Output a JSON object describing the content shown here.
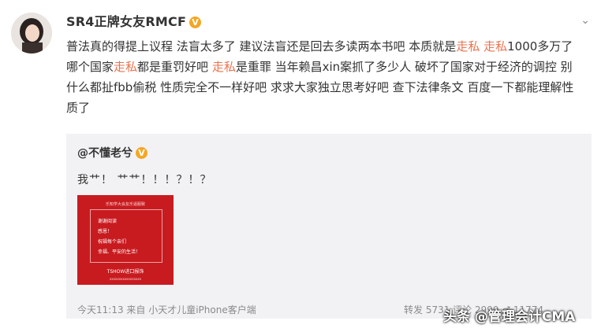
{
  "post": {
    "username": "SR4正牌女友RMCF",
    "verified_badge": "V",
    "menu_icon": "chevron-down-icon",
    "text_parts": [
      "普法真的得提上议程 法盲太多了 建议法盲还是回去多读两本书吧 本质就是",
      "走私",
      " ",
      "走私",
      "1000多万了 哪个国家",
      "走私",
      "都是重罚好吧 ",
      "走私",
      "是重罪 当年赖昌xin案抓了多少人 破坏了国家对于经济的调控 别什么都扯fbb偷税 性质完全不一样好吧 求求大家独立思考好吧 查下法律条文 百度一下都能理解性质了"
    ],
    "highlight_color": "#eb7350"
  },
  "repost": {
    "username": "@不懂老兮",
    "verified_badge": "V",
    "text": "我艹！ 艹艹！！！？！？",
    "image": {
      "header": "乐知学大会友乐逼服致",
      "lines": [
        "谢谢阅读",
        "感恩！",
        "祝福每个亲们",
        "幸福、平安的生活！"
      ],
      "footer": "TSHOW进口报饰",
      "subtext": "xxxxxxxxxxxxxxxxx"
    },
    "meta": "今天11:13 来自 小天才儿童iPhone客户端",
    "stats": "转发 5731 评论 2999 ♂ 11774"
  },
  "watermark": "头条 @管理会计CMA"
}
